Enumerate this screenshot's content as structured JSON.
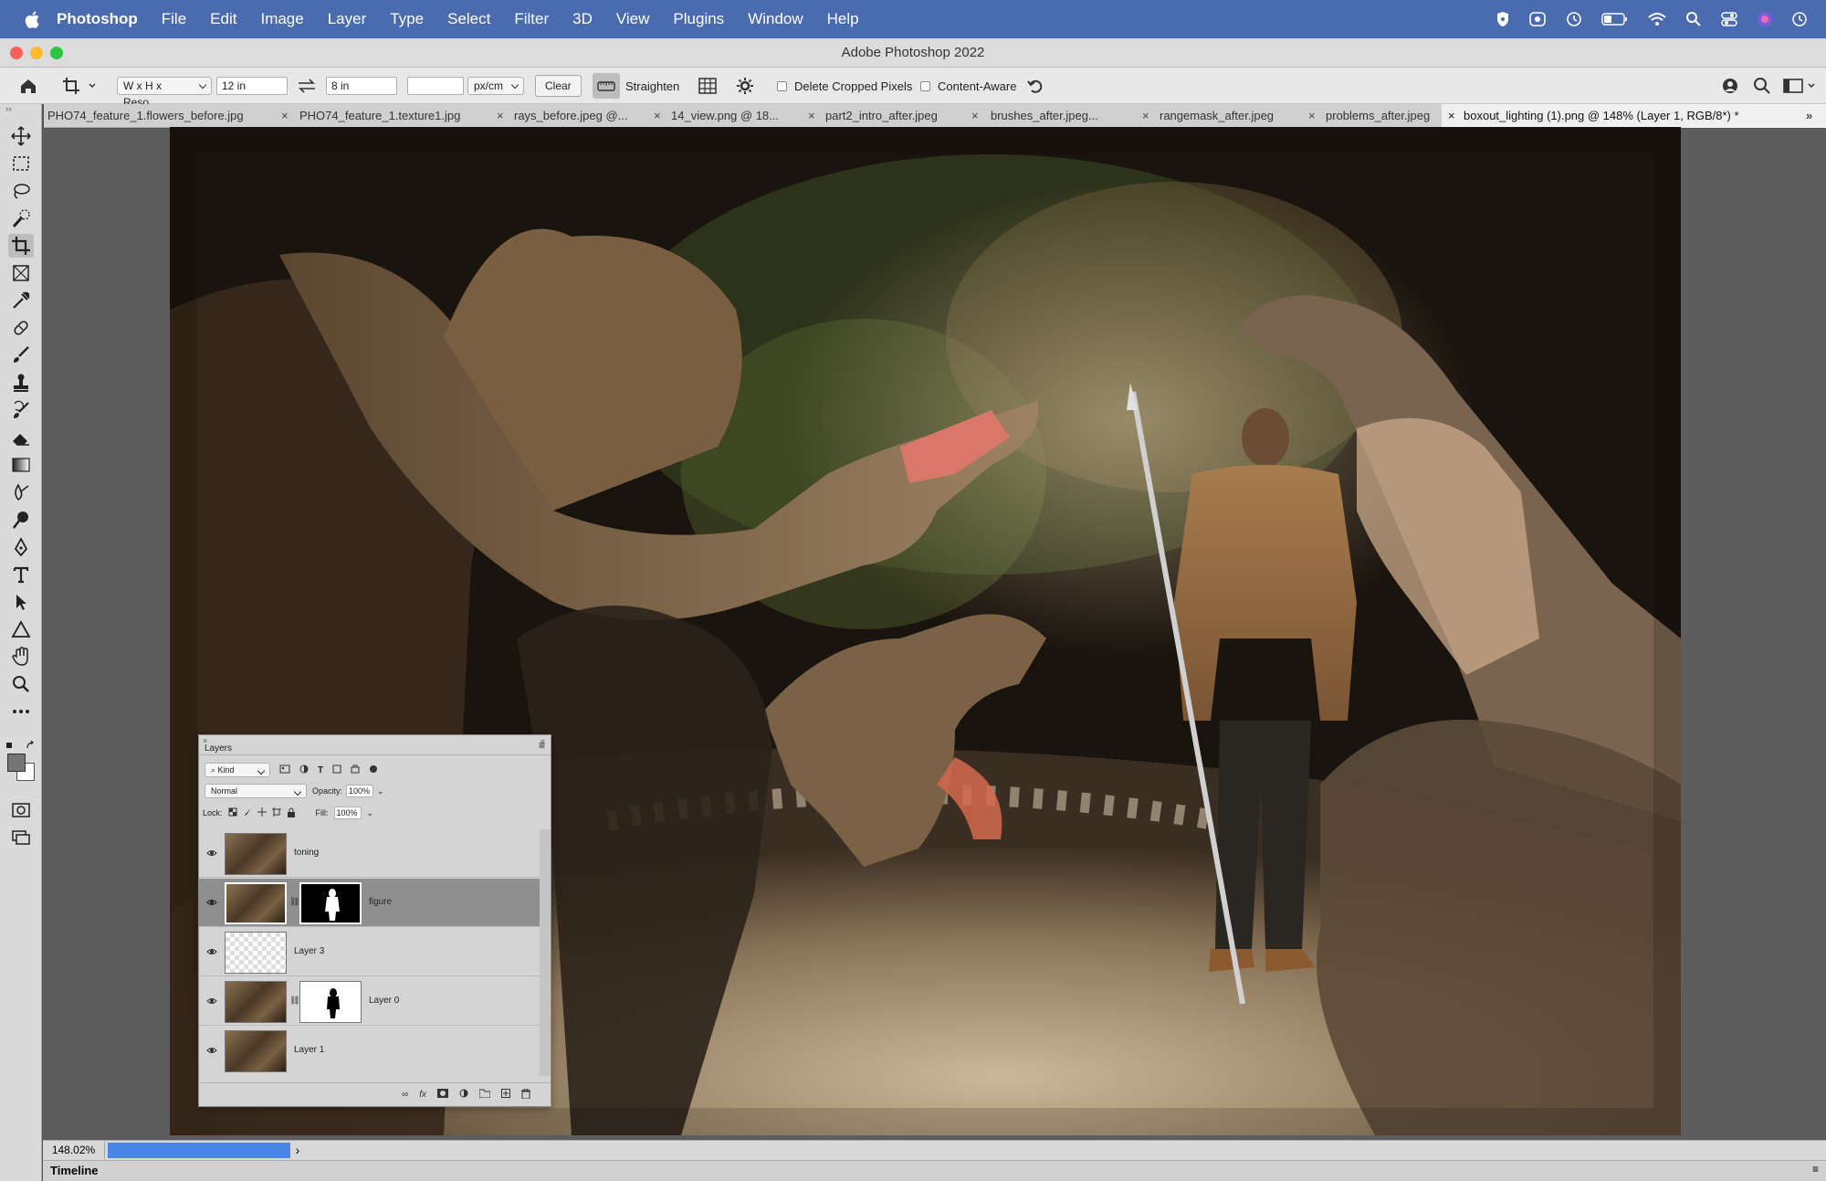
{
  "menubar": {
    "app": "Photoshop",
    "items": [
      "File",
      "Edit",
      "Image",
      "Layer",
      "Type",
      "Select",
      "Filter",
      "3D",
      "View",
      "Plugins",
      "Window",
      "Help"
    ]
  },
  "window": {
    "title": "Adobe Photoshop 2022"
  },
  "options": {
    "ratio_preset": "W x H x Reso...",
    "width": "12 in",
    "height": "8 in",
    "resolution": "",
    "unit": "px/cm",
    "clear_label": "Clear",
    "straighten_label": "Straighten",
    "delete_cropped_label": "Delete Cropped Pixels",
    "content_aware_label": "Content-Aware"
  },
  "tabs": [
    {
      "label": "PHO74_feature_1.flowers_before.jpg"
    },
    {
      "label": "PHO74_feature_1.texture1.jpg"
    },
    {
      "label": "rays_before.jpeg @..."
    },
    {
      "label": "14_view.png @ 18..."
    },
    {
      "label": "part2_intro_after.jpeg"
    },
    {
      "label": "brushes_after.jpeg..."
    },
    {
      "label": "rangemask_after.jpeg"
    },
    {
      "label": "problems_after.jpeg"
    },
    {
      "label": "boxout_lighting (1).png @ 148% (Layer 1, RGB/8*) *"
    }
  ],
  "layers_panel": {
    "title": "Layers",
    "filter_kind": "Kind",
    "blend_mode": "Normal",
    "opacity_label": "Opacity:",
    "opacity_value": "100%",
    "lock_label": "Lock:",
    "fill_label": "Fill:",
    "fill_value": "100%",
    "layers": [
      {
        "name": "toning"
      },
      {
        "name": "figure"
      },
      {
        "name": "Layer 3"
      },
      {
        "name": "Layer 0"
      },
      {
        "name": "Layer 1"
      }
    ]
  },
  "status": {
    "zoom": "148.02%"
  },
  "timeline": {
    "label": "Timeline"
  },
  "colors": {
    "menubar": "#4a6bb0",
    "progress": "#4a86e8",
    "panel": "#d4d4d4"
  }
}
